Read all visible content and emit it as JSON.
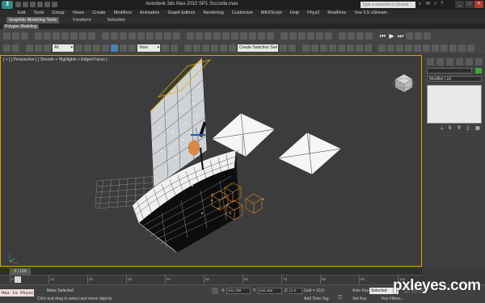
{
  "window": {
    "title": "Autodesk 3ds Max 2010 SP1    Scccella.max",
    "search_placeholder": "Type a keyword or phrase",
    "minimize": "_",
    "maximize": "□",
    "close": "✕",
    "logo": "3"
  },
  "menu": {
    "items": [
      "Edit",
      "Tools",
      "Group",
      "Views",
      "Create",
      "Modifiers",
      "Animation",
      "Graph Editors",
      "Rendering",
      "Customize",
      "MAXScript",
      "Help",
      "Phys2",
      "RealFlow",
      "Vue 6.5 xStream"
    ]
  },
  "ribbon": {
    "tabs": [
      "Graphite Modeling Tools",
      "Freeform",
      "Selection"
    ],
    "active_tab": "Graphite Modeling Tools",
    "panel_label": "Polygon Modeling"
  },
  "toolbar": {
    "selection_filter": "All",
    "reference_coord": "View",
    "named_selection": "Create Selection Se"
  },
  "viewport": {
    "label": "[ + ] [ Perspective ] [ Smooth + Highlights + Edged Faces ]"
  },
  "command_panel": {
    "modifier_list": "Modifier List",
    "object_color": "#3aa83a"
  },
  "timeline": {
    "current_frame": "0 / 100",
    "ticks": [
      "0",
      "10",
      "20",
      "30",
      "40",
      "50",
      "60",
      "70",
      "80",
      "90",
      "100"
    ]
  },
  "status": {
    "maxscript_text": "Max to Physc",
    "selection_status": "None Selected",
    "prompt": "Click and drag to select and move objects",
    "x_label": "X:",
    "x_value": "941.799",
    "y_label": "Y:",
    "y_value": "546.466",
    "z_label": "Z:",
    "z_value": "0.0",
    "grid": "Grid = 10,0",
    "add_time_tag": "Add Time Tag",
    "auto_key": "Auto Key",
    "set_key": "Set Key",
    "key_mode": "Selected",
    "key_filters": "Key Filters..."
  },
  "watermark": {
    "text": "pxleyes.com"
  }
}
